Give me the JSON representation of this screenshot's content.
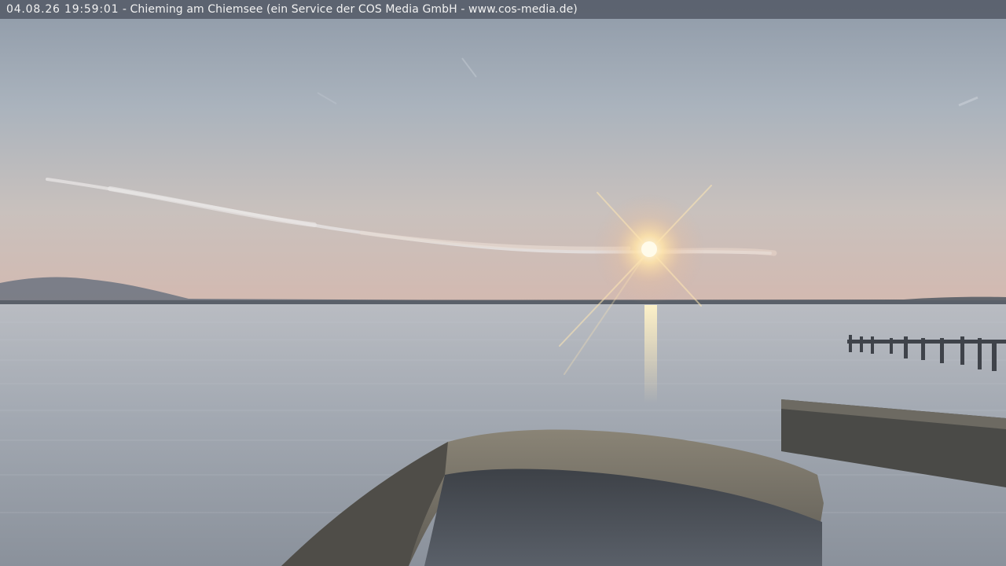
{
  "caption": {
    "timestamp": "04.08.26 19:59:01",
    "separator": " - ",
    "text": "Chieming am Chiemsee (ein Service der COS Media GmbH - www.cos-media.de)"
  },
  "scene": {
    "sky_top_color": "#9aa5b3",
    "sky_horizon_color": "#d8c0b3",
    "water_color": "#a7aeb7",
    "sun_color": "#fff6d8",
    "glare_color": "#ffd9a0"
  }
}
